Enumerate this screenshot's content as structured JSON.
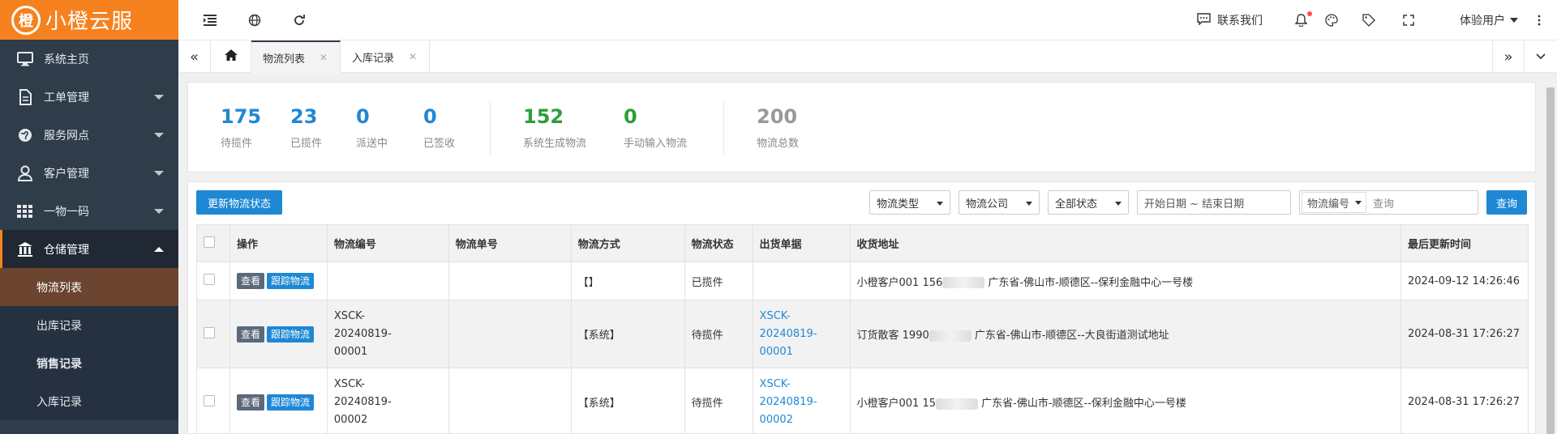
{
  "app": {
    "logo_text": "小橙云服",
    "logo_mark": "橙"
  },
  "sidebar": {
    "items": [
      {
        "label": "系统主页",
        "icon": "monitor-icon"
      },
      {
        "label": "工单管理",
        "icon": "document-icon"
      },
      {
        "label": "服务网点",
        "icon": "globe-icon"
      },
      {
        "label": "客户管理",
        "icon": "user-icon"
      },
      {
        "label": "一物一码",
        "icon": "grid-icon"
      },
      {
        "label": "仓储管理",
        "icon": "warehouse-icon"
      }
    ],
    "sub_items": [
      {
        "label": "物流列表"
      },
      {
        "label": "出库记录"
      },
      {
        "label": "销售记录"
      },
      {
        "label": "入库记录"
      }
    ]
  },
  "topbar": {
    "contact": "联系我们",
    "user": "体验用户"
  },
  "tabs": [
    {
      "label": "物流列表"
    },
    {
      "label": "入库记录"
    }
  ],
  "stats": [
    {
      "value": "175",
      "label": "待揽件",
      "color": "#1e88d4"
    },
    {
      "value": "23",
      "label": "已揽件",
      "color": "#1e88d4"
    },
    {
      "value": "0",
      "label": "派送中",
      "color": "#1e88d4"
    },
    {
      "value": "0",
      "label": "已签收",
      "color": "#1e88d4"
    },
    {
      "value": "152",
      "label": "系统生成物流",
      "color": "#2e9e3a"
    },
    {
      "value": "0",
      "label": "手动输入物流",
      "color": "#2e9e3a"
    },
    {
      "value": "200",
      "label": "物流总数",
      "color": "#999999"
    }
  ],
  "toolbar": {
    "update_button": "更新物流状态",
    "filter_type": "物流类型",
    "filter_company": "物流公司",
    "filter_status": "全部状态",
    "date_range": "开始日期 ~ 结束日期",
    "search_field": "物流编号",
    "search_placeholder": "查询",
    "search_button": "查询"
  },
  "table": {
    "columns": [
      "操作",
      "物流编号",
      "物流单号",
      "物流方式",
      "物流状态",
      "出货单据",
      "收货地址",
      "最后更新时间"
    ],
    "view_label": "查看",
    "track_label": "跟踪物流",
    "rows": [
      {
        "code": "",
        "tracking": "",
        "method": "【】",
        "status": "已揽件",
        "doc": "",
        "addr_prefix": "小橙客户001 156",
        "addr_suffix": "广东省-佛山市-顺德区--保利金融中心一号楼",
        "updated": "2024-09-12 14:26:46"
      },
      {
        "code": "XSCK-20240819-00001",
        "tracking": "",
        "method": "【系统】",
        "status": "待揽件",
        "doc": "XSCK-20240819-00001",
        "addr_prefix": "订货散客 1990",
        "addr_suffix": "广东省-佛山市-顺德区--大良街道测试地址",
        "updated": "2024-08-31 17:26:27"
      },
      {
        "code": "XSCK-20240819-00002",
        "tracking": "",
        "method": "【系统】",
        "status": "待揽件",
        "doc": "XSCK-20240819-00002",
        "addr_prefix": "小橙客户001 15",
        "addr_suffix": "广东省-佛山市-顺德区--保利金融中心一号楼",
        "updated": "2024-08-31 17:26:27"
      }
    ]
  }
}
